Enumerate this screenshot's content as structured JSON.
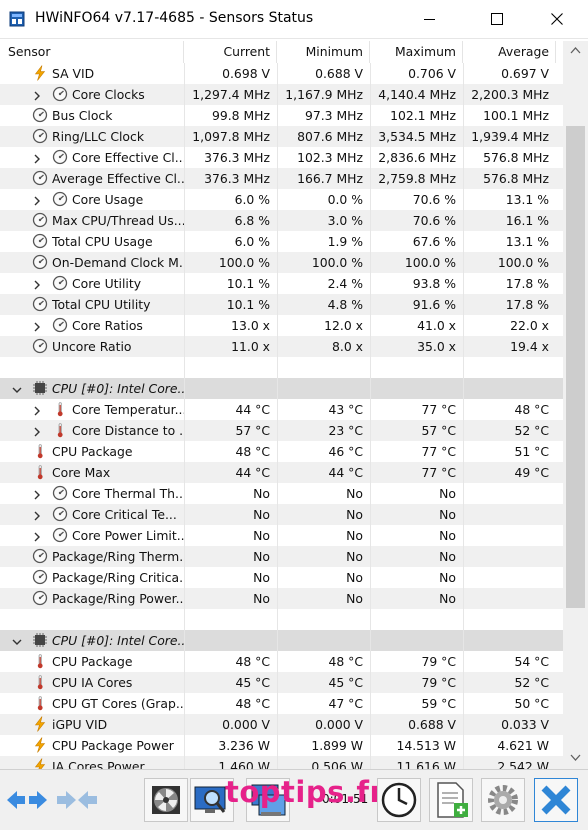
{
  "window": {
    "title": "HWiNFO64 v7.17-4685 - Sensors Status"
  },
  "columns": [
    "Sensor",
    "Current",
    "Minimum",
    "Maximum",
    "Average"
  ],
  "rows": [
    {
      "name": "SA VID",
      "icon": "lightning-icon",
      "expander": false,
      "values": [
        "0.698 V",
        "0.688 V",
        "0.706 V",
        "0.697 V"
      ]
    },
    {
      "name": "Core Clocks",
      "icon": "gauge-icon",
      "expander": true,
      "values": [
        "1,297.4 MHz",
        "1,167.9 MHz",
        "4,140.4 MHz",
        "2,200.3 MHz"
      ]
    },
    {
      "name": "Bus Clock",
      "icon": "gauge-icon",
      "expander": false,
      "values": [
        "99.8 MHz",
        "97.3 MHz",
        "102.1 MHz",
        "100.1 MHz"
      ]
    },
    {
      "name": "Ring/LLC Clock",
      "icon": "gauge-icon",
      "expander": false,
      "values": [
        "1,097.8 MHz",
        "807.6 MHz",
        "3,534.5 MHz",
        "1,939.4 MHz"
      ]
    },
    {
      "name": "Core Effective Cl...",
      "icon": "gauge-icon",
      "expander": true,
      "values": [
        "376.3 MHz",
        "102.3 MHz",
        "2,836.6 MHz",
        "576.8 MHz"
      ]
    },
    {
      "name": "Average Effective Cl...",
      "icon": "gauge-icon",
      "expander": false,
      "values": [
        "376.3 MHz",
        "166.7 MHz",
        "2,759.8 MHz",
        "576.8 MHz"
      ]
    },
    {
      "name": "Core Usage",
      "icon": "gauge-icon",
      "expander": true,
      "values": [
        "6.0 %",
        "0.0 %",
        "70.6 %",
        "13.1 %"
      ]
    },
    {
      "name": "Max CPU/Thread Us...",
      "icon": "gauge-icon",
      "expander": false,
      "values": [
        "6.8 %",
        "3.0 %",
        "70.6 %",
        "16.1 %"
      ]
    },
    {
      "name": "Total CPU Usage",
      "icon": "gauge-icon",
      "expander": false,
      "values": [
        "6.0 %",
        "1.9 %",
        "67.6 %",
        "13.1 %"
      ]
    },
    {
      "name": "On-Demand Clock M...",
      "icon": "gauge-icon",
      "expander": false,
      "values": [
        "100.0 %",
        "100.0 %",
        "100.0 %",
        "100.0 %"
      ]
    },
    {
      "name": "Core Utility",
      "icon": "gauge-icon",
      "expander": true,
      "values": [
        "10.1 %",
        "2.4 %",
        "93.8 %",
        "17.8 %"
      ]
    },
    {
      "name": "Total CPU Utility",
      "icon": "gauge-icon",
      "expander": false,
      "values": [
        "10.1 %",
        "4.8 %",
        "91.6 %",
        "17.8 %"
      ]
    },
    {
      "name": "Core Ratios",
      "icon": "gauge-icon",
      "expander": true,
      "values": [
        "13.0 x",
        "12.0 x",
        "41.0 x",
        "22.0 x"
      ]
    },
    {
      "name": "Uncore Ratio",
      "icon": "gauge-icon",
      "expander": false,
      "values": [
        "11.0 x",
        "8.0 x",
        "35.0 x",
        "19.4 x"
      ]
    },
    {
      "name": "",
      "icon": "",
      "expander": false,
      "blank": true,
      "values": [
        "",
        "",
        "",
        ""
      ]
    },
    {
      "name": "CPU [#0]: Intel Core...",
      "icon": "chip-icon",
      "group": true,
      "values": [
        "",
        "",
        "",
        ""
      ]
    },
    {
      "name": "Core Temperatur...",
      "icon": "thermometer-icon",
      "expander": true,
      "values": [
        "44 °C",
        "43 °C",
        "77 °C",
        "48 °C"
      ]
    },
    {
      "name": "Core Distance to ...",
      "icon": "thermometer-icon",
      "expander": true,
      "values": [
        "57 °C",
        "23 °C",
        "57 °C",
        "52 °C"
      ]
    },
    {
      "name": "CPU Package",
      "icon": "thermometer-icon",
      "expander": false,
      "values": [
        "48 °C",
        "46 °C",
        "77 °C",
        "51 °C"
      ]
    },
    {
      "name": "Core Max",
      "icon": "thermometer-icon",
      "expander": false,
      "values": [
        "44 °C",
        "44 °C",
        "77 °C",
        "49 °C"
      ]
    },
    {
      "name": "Core Thermal Th...",
      "icon": "gauge-icon",
      "expander": true,
      "values": [
        "No",
        "No",
        "No",
        ""
      ]
    },
    {
      "name": "Core Critical Te...",
      "icon": "gauge-icon",
      "expander": true,
      "values": [
        "No",
        "No",
        "No",
        ""
      ]
    },
    {
      "name": "Core Power Limit...",
      "icon": "gauge-icon",
      "expander": true,
      "values": [
        "No",
        "No",
        "No",
        ""
      ]
    },
    {
      "name": "Package/Ring Therm...",
      "icon": "gauge-icon",
      "expander": false,
      "values": [
        "No",
        "No",
        "No",
        ""
      ]
    },
    {
      "name": "Package/Ring Critica...",
      "icon": "gauge-icon",
      "expander": false,
      "values": [
        "No",
        "No",
        "No",
        ""
      ]
    },
    {
      "name": "Package/Ring Power...",
      "icon": "gauge-icon",
      "expander": false,
      "values": [
        "No",
        "No",
        "No",
        ""
      ]
    },
    {
      "name": "",
      "icon": "",
      "expander": false,
      "blank": true,
      "values": [
        "",
        "",
        "",
        ""
      ]
    },
    {
      "name": "CPU [#0]: Intel Core...",
      "icon": "chip-icon",
      "group": true,
      "values": [
        "",
        "",
        "",
        ""
      ]
    },
    {
      "name": "CPU Package",
      "icon": "thermometer-icon",
      "expander": false,
      "values": [
        "48 °C",
        "48 °C",
        "79 °C",
        "54 °C"
      ]
    },
    {
      "name": "CPU IA Cores",
      "icon": "thermometer-icon",
      "expander": false,
      "values": [
        "45 °C",
        "45 °C",
        "79 °C",
        "52 °C"
      ]
    },
    {
      "name": "CPU GT Cores (Grap...",
      "icon": "thermometer-icon",
      "expander": false,
      "values": [
        "48 °C",
        "47 °C",
        "59 °C",
        "50 °C"
      ]
    },
    {
      "name": "iGPU VID",
      "icon": "lightning-icon",
      "expander": false,
      "values": [
        "0.000 V",
        "0.000 V",
        "0.688 V",
        "0.033 V"
      ]
    },
    {
      "name": "CPU Package Power",
      "icon": "lightning-icon",
      "expander": false,
      "values": [
        "3.236 W",
        "1.899 W",
        "14.513 W",
        "4.621 W"
      ]
    },
    {
      "name": "IA Cores Power",
      "icon": "lightning-icon",
      "expander": false,
      "values": [
        "1.460 W",
        "0.506 W",
        "11.616 W",
        "2.542 W"
      ]
    }
  ],
  "toolbar": {
    "timer": "0:01:51",
    "watermark": "toptips.fr",
    "buttons": [
      "arrows-left-right-icon",
      "arrows-collapse-icon",
      "fan-icon",
      "monitor-search-icon",
      "network-monitor-icon",
      "clock-icon",
      "add-report-icon",
      "settings-gear-icon",
      "close-x-icon"
    ]
  },
  "colors": {
    "gauge": "#555555",
    "thermometer": "#c0392b",
    "lightning": "#f2a500",
    "close_button": "#2f86d6",
    "watermark": "#e6228a"
  }
}
